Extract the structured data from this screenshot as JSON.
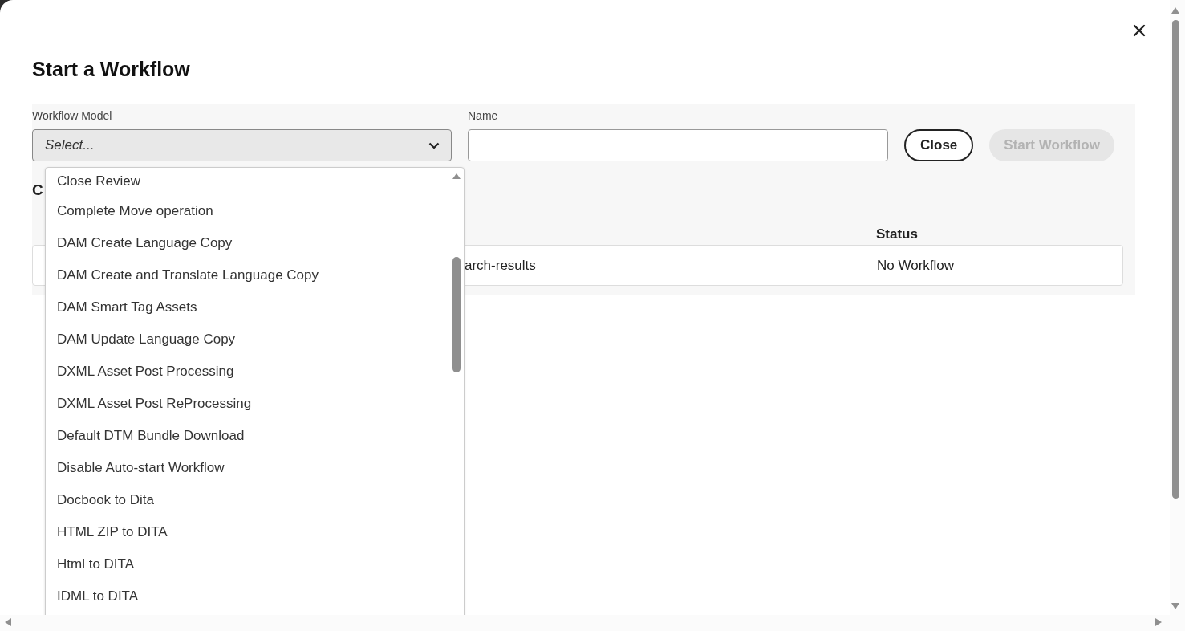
{
  "dialog": {
    "title": "Start a Workflow"
  },
  "form": {
    "workflow_model": {
      "label": "Workflow Model",
      "placeholder": "Select...",
      "expanded": true
    },
    "name": {
      "label": "Name"
    },
    "buttons": [
      {
        "label": "Close",
        "disabled": false
      },
      {
        "label": "Start Workflow",
        "disabled": true
      }
    ]
  },
  "section": {
    "heading": "C"
  },
  "table": {
    "status_header": "Status",
    "rows": [
      {
        "column_2": "arch-results",
        "status": "No Workflow"
      }
    ]
  },
  "dropdown": {
    "options": [
      "Close Review",
      "Complete Move operation",
      "DAM Create Language Copy",
      "DAM Create and Translate Language Copy",
      "DAM Smart Tag Assets",
      "DAM Update Language Copy",
      "DXML Asset Post Processing",
      "DXML Asset Post ReProcessing",
      "Default DTM Bundle Download",
      "Disable Auto-start Workflow",
      "Docbook to Dita",
      "HTML ZIP to DITA",
      "Html to DITA",
      "IDML to DITA"
    ]
  }
}
